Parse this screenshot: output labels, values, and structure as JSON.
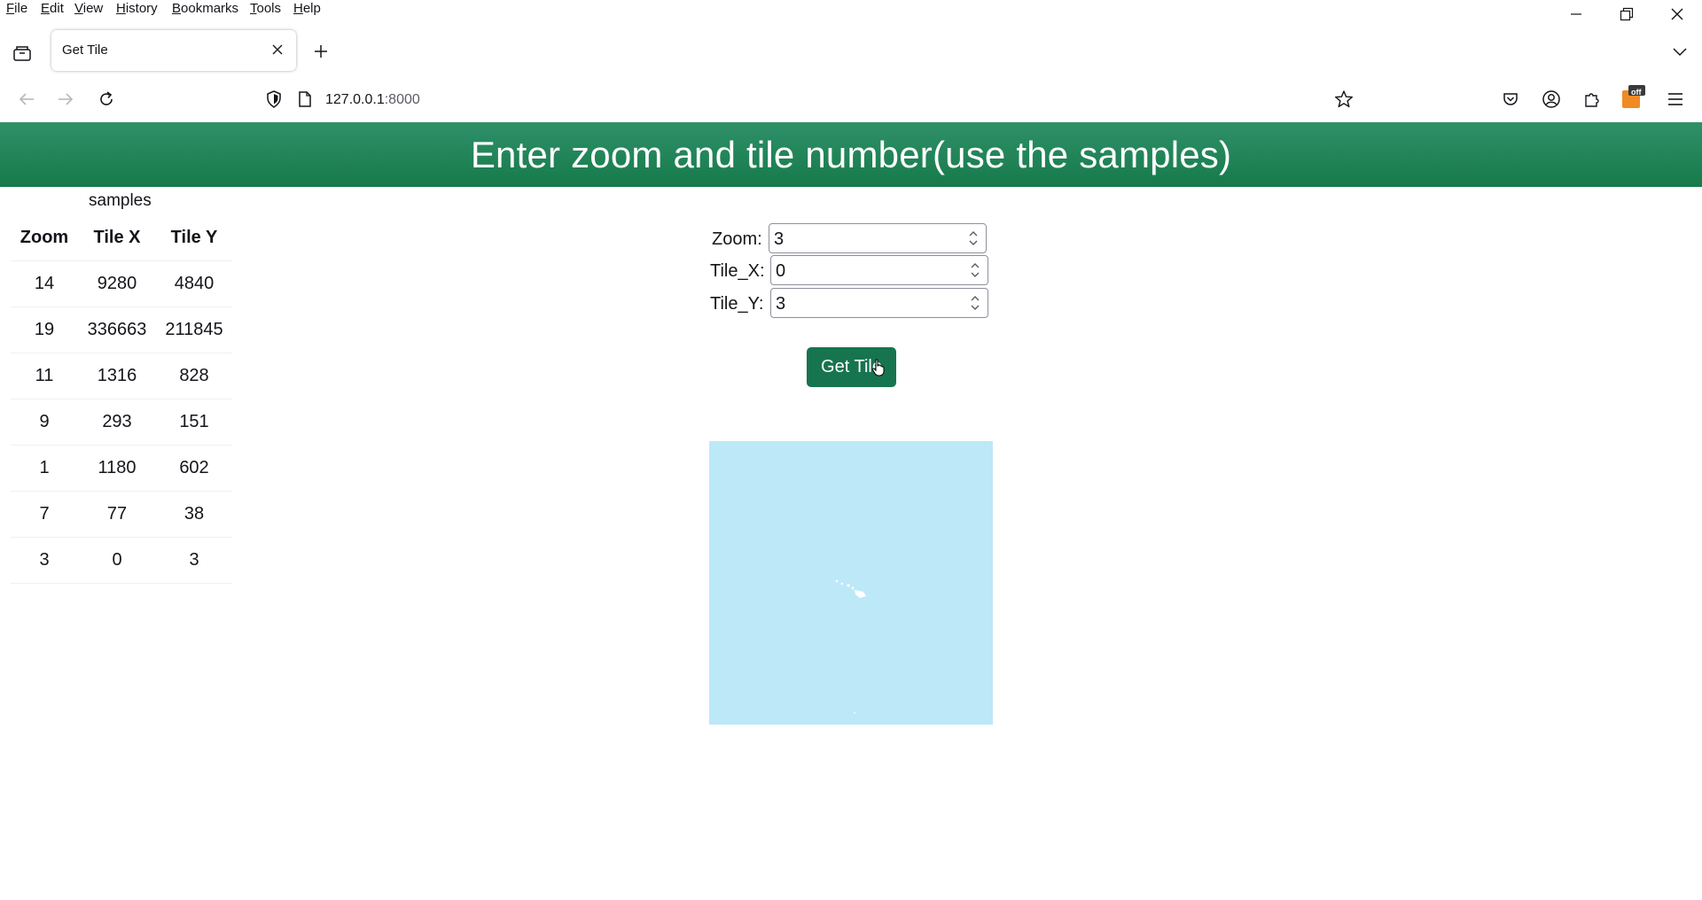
{
  "menu": {
    "items": [
      {
        "accel": "F",
        "rest": "ile"
      },
      {
        "accel": "E",
        "rest": "dit"
      },
      {
        "accel": "V",
        "rest": "iew"
      },
      {
        "accel": "H",
        "rest": "istory"
      },
      {
        "accel": "B",
        "rest": "ookmarks"
      },
      {
        "accel": "T",
        "rest": "ools"
      },
      {
        "accel": "H",
        "rest": "elp"
      }
    ]
  },
  "tab": {
    "title": "Get Tile"
  },
  "url": {
    "host": "127.0.0.1",
    "port": ":8000"
  },
  "extension_badge": "off",
  "page": {
    "heading": "Enter zoom and tile number(use the samples)",
    "samples_caption": "samples",
    "table": {
      "headers": [
        "Zoom",
        "Tile X",
        "Tile Y"
      ],
      "rows": [
        [
          "14",
          "9280",
          "4840"
        ],
        [
          "19",
          "336663",
          "211845"
        ],
        [
          "11",
          "1316",
          "828"
        ],
        [
          "9",
          "293",
          "151"
        ],
        [
          "1",
          "1180",
          "602"
        ],
        [
          "7",
          "77",
          "38"
        ],
        [
          "3",
          "0",
          "3"
        ]
      ]
    },
    "form": {
      "zoom_label": "Zoom:",
      "zoom_value": "3",
      "tile_x_label": "Tile_X:",
      "tile_x_value": "0",
      "tile_y_label": "Tile_Y:",
      "tile_y_value": "3",
      "button_label": "Get Tile"
    }
  },
  "colors": {
    "header_green": "#1f8155",
    "button_green": "#16744f",
    "tile_water": "#bde8f7",
    "extension_orange": "#f08a24"
  }
}
